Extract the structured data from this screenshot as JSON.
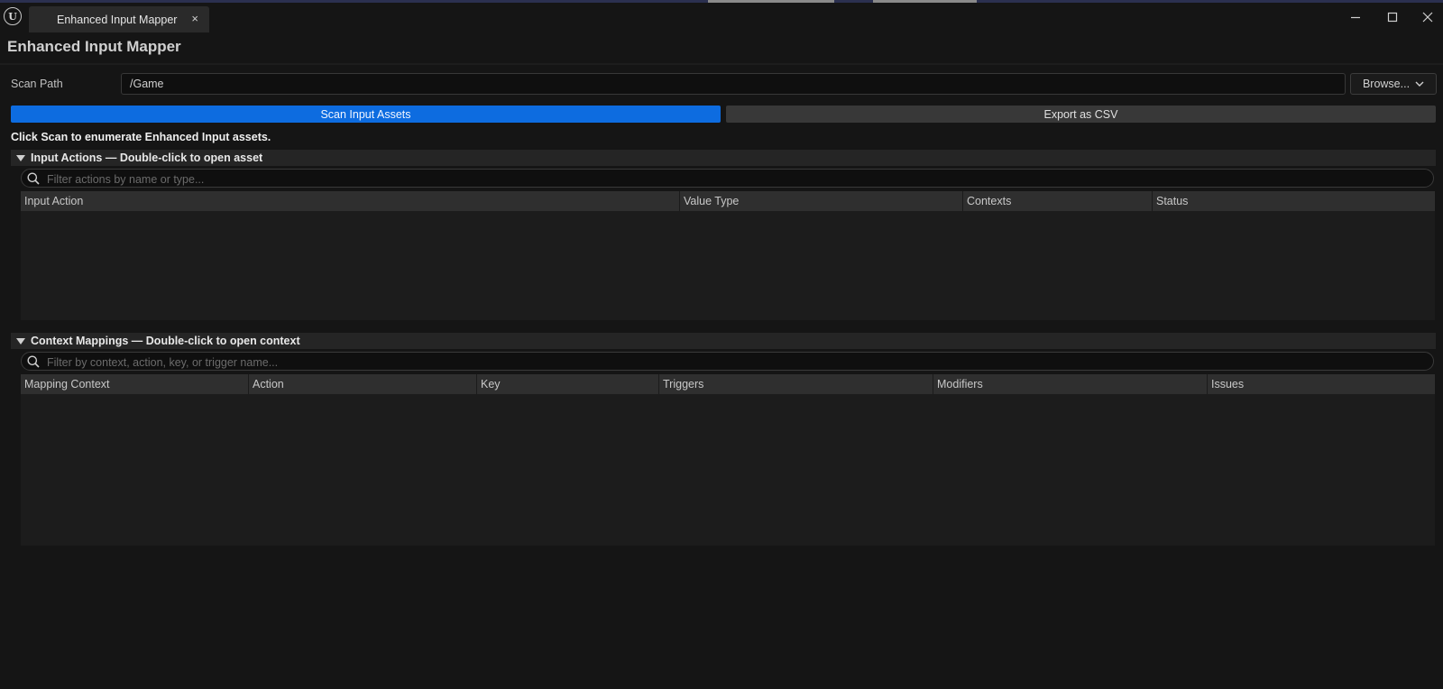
{
  "window": {
    "tab_title": "Enhanced Input Mapper",
    "tab_close_glyph": "×",
    "logo_glyph": "U",
    "controls": [
      "minimize-icon",
      "maximize-icon",
      "close-icon"
    ]
  },
  "panel": {
    "title": "Enhanced Input Mapper"
  },
  "scan": {
    "label": "Scan Path",
    "path_value": "/Game",
    "browse_label": "Browse...",
    "scan_button": "Scan Input Assets",
    "export_button": "Export as CSV",
    "status_message": "Click Scan to enumerate Enhanced Input assets."
  },
  "input_actions": {
    "header": "Input Actions — Double-click to open asset",
    "filter_placeholder": "Filter actions by name or type...",
    "columns": [
      "Input Action",
      "Value Type",
      "Contexts",
      "Status"
    ],
    "rows": []
  },
  "context_mappings": {
    "header": "Context Mappings — Double-click to open context",
    "filter_placeholder": "Filter by context, action, key, or trigger name...",
    "columns": [
      "Mapping Context",
      "Action",
      "Key",
      "Triggers",
      "Modifiers",
      "Issues"
    ],
    "rows": []
  },
  "colors": {
    "accent": "#0d6ce0",
    "background": "#151515",
    "panel": "#1c1c1c",
    "header": "#2f2f2f"
  }
}
